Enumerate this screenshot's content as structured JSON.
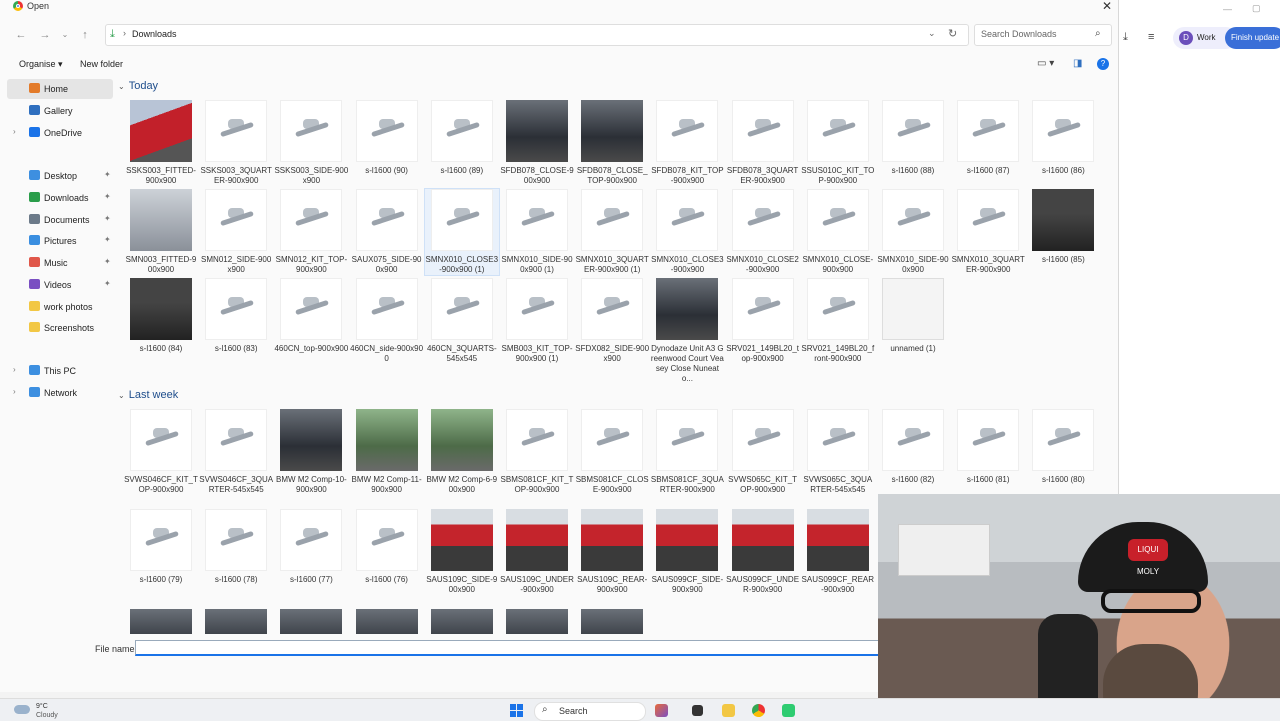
{
  "dialog": {
    "title": "Open",
    "close_glyph": "✕",
    "address": {
      "icon": "download-icon",
      "crumb": "Downloads"
    },
    "search_placeholder": "Search Downloads",
    "toolbar": {
      "organise": "Organise ▾",
      "new_folder": "New folder",
      "help": "?"
    }
  },
  "sidebar": {
    "items": [
      {
        "label": "Home",
        "color": "#e37b2a",
        "selected": true
      },
      {
        "label": "Gallery",
        "color": "#2f6fbf"
      },
      {
        "label": "OneDrive",
        "color": "#1a73e8",
        "expandable": true
      },
      {
        "label": "Desktop",
        "color": "#3d8fe0",
        "pinned": true
      },
      {
        "label": "Downloads",
        "color": "#2a9d4a",
        "pinned": true
      },
      {
        "label": "Documents",
        "color": "#6c7a89",
        "pinned": true
      },
      {
        "label": "Pictures",
        "color": "#3a8ee0",
        "pinned": true
      },
      {
        "label": "Music",
        "color": "#e0574a",
        "pinned": true
      },
      {
        "label": "Videos",
        "color": "#7a4fc2",
        "pinned": true
      },
      {
        "label": "work photos",
        "color": "#f2c744"
      },
      {
        "label": "Screenshots",
        "color": "#f2c744"
      },
      {
        "label": "This PC",
        "color": "#3d8fe0",
        "expandable": true
      },
      {
        "label": "Network",
        "color": "#3d8fe0",
        "expandable": true
      }
    ]
  },
  "groups": [
    {
      "title": "Today",
      "files": [
        {
          "name": "SSKS003_FITTED-900x900",
          "kind": "red"
        },
        {
          "name": "SSKS003_3QUARTER-900x900",
          "kind": "white"
        },
        {
          "name": "SSKS003_SIDE-900x900",
          "kind": "white"
        },
        {
          "name": "s-l1600 (90)",
          "kind": "white"
        },
        {
          "name": "s-l1600 (89)",
          "kind": "white"
        },
        {
          "name": "SFDB078_CLOSE-900x900",
          "kind": "dark"
        },
        {
          "name": "SFDB078_CLOSE_TOP-900x900",
          "kind": "dark"
        },
        {
          "name": "SFDB078_KIT_TOP-900x900",
          "kind": "white"
        },
        {
          "name": "SFDB078_3QUARTER-900x900",
          "kind": "white"
        },
        {
          "name": "SSUS010C_KIT_TOP-900x900",
          "kind": "white"
        },
        {
          "name": "s-l1600 (88)",
          "kind": "white"
        },
        {
          "name": "s-l1600 (87)",
          "kind": "white"
        },
        {
          "name": "s-l1600 (86)",
          "kind": "white"
        },
        {
          "name": "SMN003_FITTED-900x900",
          "kind": "grey"
        },
        {
          "name": "SMN012_SIDE-900x900",
          "kind": "white"
        },
        {
          "name": "SMN012_KIT_TOP-900x900",
          "kind": "white"
        },
        {
          "name": "SAUX075_SIDE-900x900",
          "kind": "white"
        },
        {
          "name": "SMNX010_CLOSE3-900x900 (1)",
          "kind": "white",
          "hover": true
        },
        {
          "name": "SMNX010_SIDE-900x900 (1)",
          "kind": "white"
        },
        {
          "name": "SMNX010_3QUARTER-900x900 (1)",
          "kind": "white"
        },
        {
          "name": "SMNX010_CLOSE3-900x900",
          "kind": "white"
        },
        {
          "name": "SMNX010_CLOSE2-900x900",
          "kind": "white"
        },
        {
          "name": "SMNX010_CLOSE-900x900",
          "kind": "white"
        },
        {
          "name": "SMNX010_SIDE-900x900",
          "kind": "white"
        },
        {
          "name": "SMNX010_3QUARTER-900x900",
          "kind": "white"
        },
        {
          "name": "s-l1600 (85)",
          "kind": "black"
        },
        {
          "name": "s-l1600 (84)",
          "kind": "black"
        },
        {
          "name": "s-l1600 (83)",
          "kind": "white"
        },
        {
          "name": "460CN_top-900x900",
          "kind": "white"
        },
        {
          "name": "460CN_side-900x900",
          "kind": "white"
        },
        {
          "name": "460CN_3QUARTS-545x545",
          "kind": "white"
        },
        {
          "name": "SMB003_KIT_TOP-900x900 (1)",
          "kind": "white"
        },
        {
          "name": "SFDX082_SIDE-900x900",
          "kind": "white"
        },
        {
          "name": "Dynodaze Unit A3 Greenwood Court Veasey Close Nuneato...",
          "kind": "dark"
        },
        {
          "name": "SRV021_149BL20_top-900x900",
          "kind": "white"
        },
        {
          "name": "SRV021_149BL20_front-900x900",
          "kind": "white"
        },
        {
          "name": "unnamed (1)",
          "kind": "doc"
        }
      ]
    },
    {
      "title": "Last week",
      "files": [
        {
          "name": "SVWS046CF_KIT_TOP-900x900",
          "kind": "white"
        },
        {
          "name": "SVWS046CF_3QUARTER-545x545",
          "kind": "white"
        },
        {
          "name": "BMW M2 Comp-10-900x900",
          "kind": "dark"
        },
        {
          "name": "BMW M2 Comp-11-900x900",
          "kind": "green"
        },
        {
          "name": "BMW M2 Comp-6-900x900",
          "kind": "green"
        },
        {
          "name": "SBMS081CF_KIT_TOP-900x900",
          "kind": "white"
        },
        {
          "name": "SBMS081CF_CLOSE-900x900",
          "kind": "white"
        },
        {
          "name": "SBMS081CF_3QUARTER-900x900",
          "kind": "white"
        },
        {
          "name": "SVWS065C_KIT_TOP-900x900",
          "kind": "white"
        },
        {
          "name": "SVWS065C_3QUARTER-545x545",
          "kind": "white"
        },
        {
          "name": "s-l1600 (82)",
          "kind": "white"
        },
        {
          "name": "s-l1600 (81)",
          "kind": "white"
        },
        {
          "name": "s-l1600 (80)",
          "kind": "white"
        },
        {
          "name": "s-l1600 (79)",
          "kind": "white"
        },
        {
          "name": "s-l1600 (78)",
          "kind": "white"
        },
        {
          "name": "s-l1600 (77)",
          "kind": "white"
        },
        {
          "name": "s-l1600 (76)",
          "kind": "white"
        },
        {
          "name": "SAUS109C_SIDE-900x900",
          "kind": "shop"
        },
        {
          "name": "SAUS109C_UNDER-900x900",
          "kind": "shop"
        },
        {
          "name": "SAUS109C_REAR-900x900",
          "kind": "shop"
        },
        {
          "name": "SAUS099CF_SIDE-900x900",
          "kind": "shop"
        },
        {
          "name": "SAUS099CF_UNDER-900x900",
          "kind": "shop"
        },
        {
          "name": "SAUS099CF_REAR-900x900",
          "kind": "shop"
        },
        {
          "name": "",
          "kind": "dark"
        },
        {
          "name": "",
          "kind": "dark"
        },
        {
          "name": "",
          "kind": "dark"
        },
        {
          "name": "",
          "kind": "dark"
        },
        {
          "name": "",
          "kind": "dark"
        },
        {
          "name": "",
          "kind": "dark"
        },
        {
          "name": "",
          "kind": "dark"
        },
        {
          "name": "",
          "kind": "dark"
        },
        {
          "name": "",
          "kind": "dark"
        },
        {
          "name": "",
          "kind": "dark"
        }
      ]
    }
  ],
  "filename": {
    "label": "File name:",
    "value": ""
  },
  "browser": {
    "profile_initial": "D",
    "profile": "Work",
    "update_button": "Finish update"
  },
  "webcam": {
    "cap_logo": "LIQUI MOLY"
  },
  "taskbar": {
    "temp": "9°C",
    "condition": "Cloudy",
    "search_label": "Search"
  },
  "colors": {
    "accent": "#1a73e8",
    "group_header": "#1f4e8c"
  }
}
